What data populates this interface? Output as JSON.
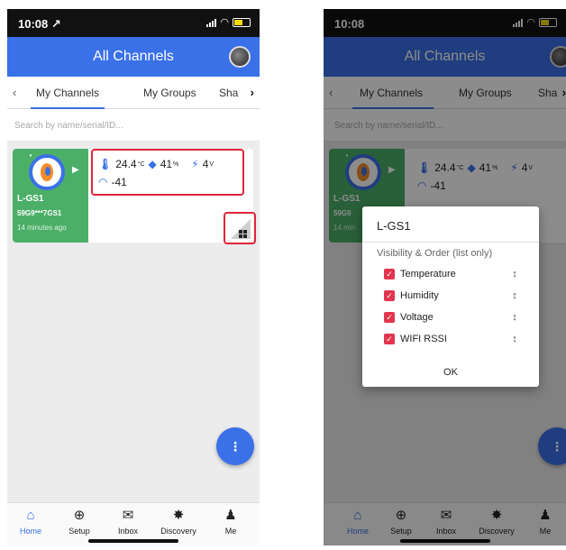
{
  "left": {
    "status_time": "10:08 ↗",
    "header_title": "All Channels",
    "tabs": [
      "My Channels",
      "My Groups",
      "Sha"
    ],
    "search_placeholder": "Search by name/serial/ID...",
    "card": {
      "name": "L-GS1",
      "serial": "59G9***7GS1",
      "last_seen": "14 minutes ago",
      "temperature": "24.4",
      "temperature_unit": "°C",
      "humidity": "41",
      "humidity_unit": "%",
      "voltage": "4",
      "voltage_unit": "V",
      "rssi": "-41"
    },
    "fab_label": "⋮",
    "nav": [
      {
        "label": "Home",
        "icon": "home-icon",
        "glyph": "⌂"
      },
      {
        "label": "Setup",
        "icon": "plus-circle-icon",
        "glyph": "⊕"
      },
      {
        "label": "Inbox",
        "icon": "mail-icon",
        "glyph": "✉"
      },
      {
        "label": "Discovery",
        "icon": "fan-icon",
        "glyph": "✸"
      },
      {
        "label": "Me",
        "icon": "person-icon",
        "glyph": "♟"
      }
    ]
  },
  "right": {
    "status_time": "10:08",
    "header_title": "All Channels",
    "tabs": [
      "My Channels",
      "My Groups",
      "Sha"
    ],
    "search_placeholder": "Search by name/serial/ID...",
    "card": {
      "name": "L-GS1",
      "serial": "59G9",
      "last_seen": "14 min",
      "temperature": "24.4",
      "temperature_unit": "°C",
      "humidity": "41",
      "humidity_unit": "%",
      "voltage": "4",
      "voltage_unit": "V",
      "rssi": "-41"
    },
    "dialog": {
      "title": "L-GS1",
      "subtitle": "Visibility & Order (list only)",
      "items": [
        {
          "label": "Temperature",
          "checked": true
        },
        {
          "label": "Humidity",
          "checked": true
        },
        {
          "label": "Voltage",
          "checked": true
        },
        {
          "label": "WIFI RSSI",
          "checked": true
        }
      ],
      "ok_label": "OK"
    },
    "fab_label": "⋮",
    "nav": [
      {
        "label": "Home",
        "icon": "home-icon",
        "glyph": "⌂"
      },
      {
        "label": "Setup",
        "icon": "plus-circle-icon",
        "glyph": "⊕"
      },
      {
        "label": "Inbox",
        "icon": "mail-icon",
        "glyph": "✉"
      },
      {
        "label": "Discovery",
        "icon": "fan-icon",
        "glyph": "✸"
      },
      {
        "label": "Me",
        "icon": "person-icon",
        "glyph": "♟"
      }
    ]
  },
  "colors": {
    "header": "#3a70e8",
    "card_green": "#4caf68",
    "highlight_red": "#e0243a",
    "checkbox": "#e2354e"
  }
}
